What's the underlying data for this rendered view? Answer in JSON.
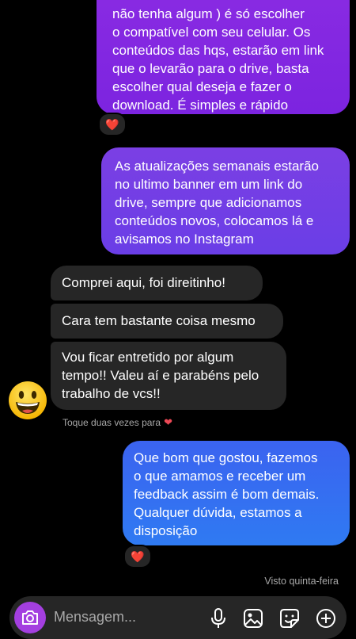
{
  "messages": {
    "sent_1": {
      "lines": [
        "não tenha algum ) é só escolher",
        "o compatível com seu celular. Os",
        "conteúdos das hqs, estarão em link",
        "que o levarão para o drive, basta",
        "escolher qual deseja e fazer o",
        "download. É simples e rápido"
      ],
      "reaction": "❤️"
    },
    "sent_2": {
      "lines": [
        "As atualizações semanais estarão",
        "no ultimo banner em um link do",
        "drive, sempre que adicionamos",
        "conteúdos novos, colocamos lá e",
        "avisamos no Instagram"
      ]
    },
    "received": [
      {
        "lines": [
          "Comprei aqui, foi direitinho!"
        ]
      },
      {
        "lines": [
          "Cara tem bastante coisa mesmo"
        ]
      },
      {
        "lines": [
          "Vou ficar entretido por algum",
          "tempo!! Valeu aí e parabéns pelo",
          "trabalho de vcs!!"
        ]
      }
    ],
    "double_tap_hint": "Toque duas vezes para",
    "hint_icon": "heart",
    "sent_3": {
      "lines": [
        "Que bom que gostou, fazemos",
        "o que amamos e receber um",
        "feedback assim é bom demais.",
        "Qualquer dúvida, estamos a",
        "disposição"
      ],
      "reaction": "❤️"
    },
    "seen_status": "Visto quinta-feira"
  },
  "avatar": {
    "icon": "grinning-emoji"
  },
  "composer": {
    "placeholder": "Mensagem...",
    "camera_icon": "camera-icon",
    "tools": [
      "microphone-icon",
      "gallery-icon",
      "sticker-icon",
      "plus-icon"
    ]
  },
  "colors": {
    "background": "#000000",
    "received_bubble": "#262626",
    "sent_gradient_top": "#8a2be2",
    "sent_gradient_bottom": "#3b63f0",
    "heart": "#ed4956",
    "camera_button": "#a43fe0"
  }
}
